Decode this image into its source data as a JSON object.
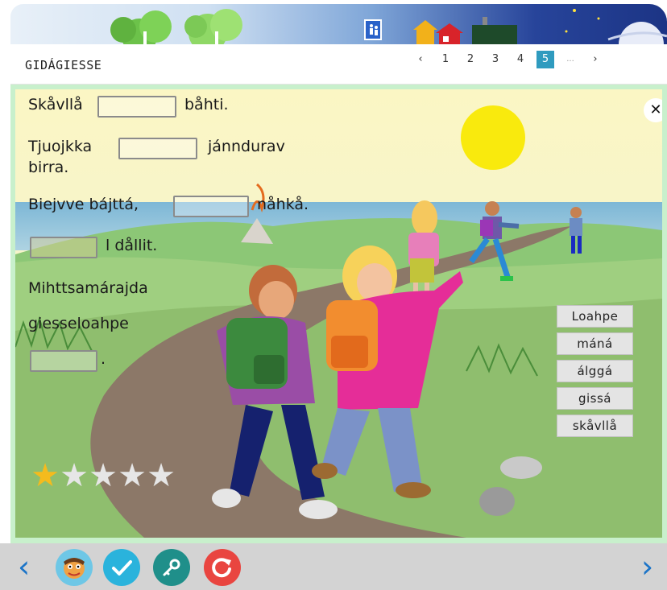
{
  "header": {
    "title": "GIDÁGIESSE",
    "pager": {
      "prev": "‹",
      "pages": [
        "1",
        "2",
        "3",
        "4",
        "5"
      ],
      "active": "5",
      "ellipsis": "...",
      "next": "›"
    }
  },
  "exercise": {
    "line1": {
      "before": "Skåvllå",
      "after": "båhti."
    },
    "line2": {
      "before": "Tjuojkka",
      "after": "jánndurav",
      "cont": "birra."
    },
    "line3": {
      "before": "Biejvve bájttá,",
      "after": "nåhkå."
    },
    "line4": {
      "after": "l dållit."
    },
    "line5": {
      "text1": "Mihttsamárajda",
      "text2": "giesseloahpe",
      "end": "."
    },
    "close": "✕"
  },
  "word_bank": [
    "Loahpe",
    "máná",
    "álggá",
    "gissá",
    "skåvllå"
  ],
  "stars": {
    "filled": 1,
    "total": 5,
    "filled_color": "#f5bb1d",
    "empty_color": "#e6e6e6",
    "glyph": "★"
  },
  "bottom": {
    "prev": "‹",
    "next": "›"
  },
  "colors": {
    "accent": "#2f9bbf",
    "check": "#2ab3dc",
    "key": "#1f8f8a",
    "reset": "#e94540",
    "nav": "#1b74c8"
  },
  "icons": [
    "mascot-icon",
    "check-icon",
    "key-icon",
    "reset-icon"
  ]
}
